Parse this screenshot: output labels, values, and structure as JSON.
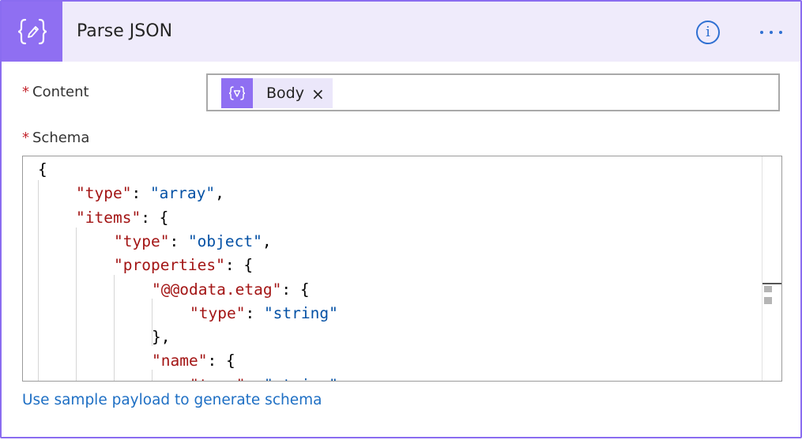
{
  "header": {
    "title": "Parse JSON",
    "icon": "json-braces-pencil-icon",
    "info_label": "i",
    "accent_color": "#8f6ff2",
    "background_color": "#efebfb"
  },
  "content_field": {
    "label": "Content",
    "required_marker": "*",
    "token": {
      "label": "Body",
      "icon": "expression-token-icon",
      "remove_label": "×"
    }
  },
  "schema_field": {
    "label": "Schema",
    "required_marker": "*",
    "lines": [
      {
        "indent": 0,
        "key": "",
        "sep": "",
        "value": "",
        "after": "{"
      },
      {
        "indent": 1,
        "key": "\"type\"",
        "sep": ": ",
        "value": "\"array\"",
        "after": ","
      },
      {
        "indent": 1,
        "key": "\"items\"",
        "sep": ": ",
        "value": "",
        "after": "{"
      },
      {
        "indent": 2,
        "key": "\"type\"",
        "sep": ": ",
        "value": "\"object\"",
        "after": ","
      },
      {
        "indent": 2,
        "key": "\"properties\"",
        "sep": ": ",
        "value": "",
        "after": "{"
      },
      {
        "indent": 3,
        "key": "\"@@odata.etag\"",
        "sep": ": ",
        "value": "",
        "after": "{"
      },
      {
        "indent": 4,
        "key": "\"type\"",
        "sep": ": ",
        "value": "\"string\"",
        "after": ""
      },
      {
        "indent": 3,
        "key": "",
        "sep": "",
        "value": "",
        "after": "},"
      },
      {
        "indent": 3,
        "key": "\"name\"",
        "sep": ": ",
        "value": "",
        "after": "{"
      },
      {
        "indent": 4,
        "key": "\"type\"",
        "sep": ": ",
        "value": "\"string\"",
        "after": ""
      }
    ]
  },
  "footer": {
    "sample_payload_link": "Use sample payload to generate schema"
  }
}
